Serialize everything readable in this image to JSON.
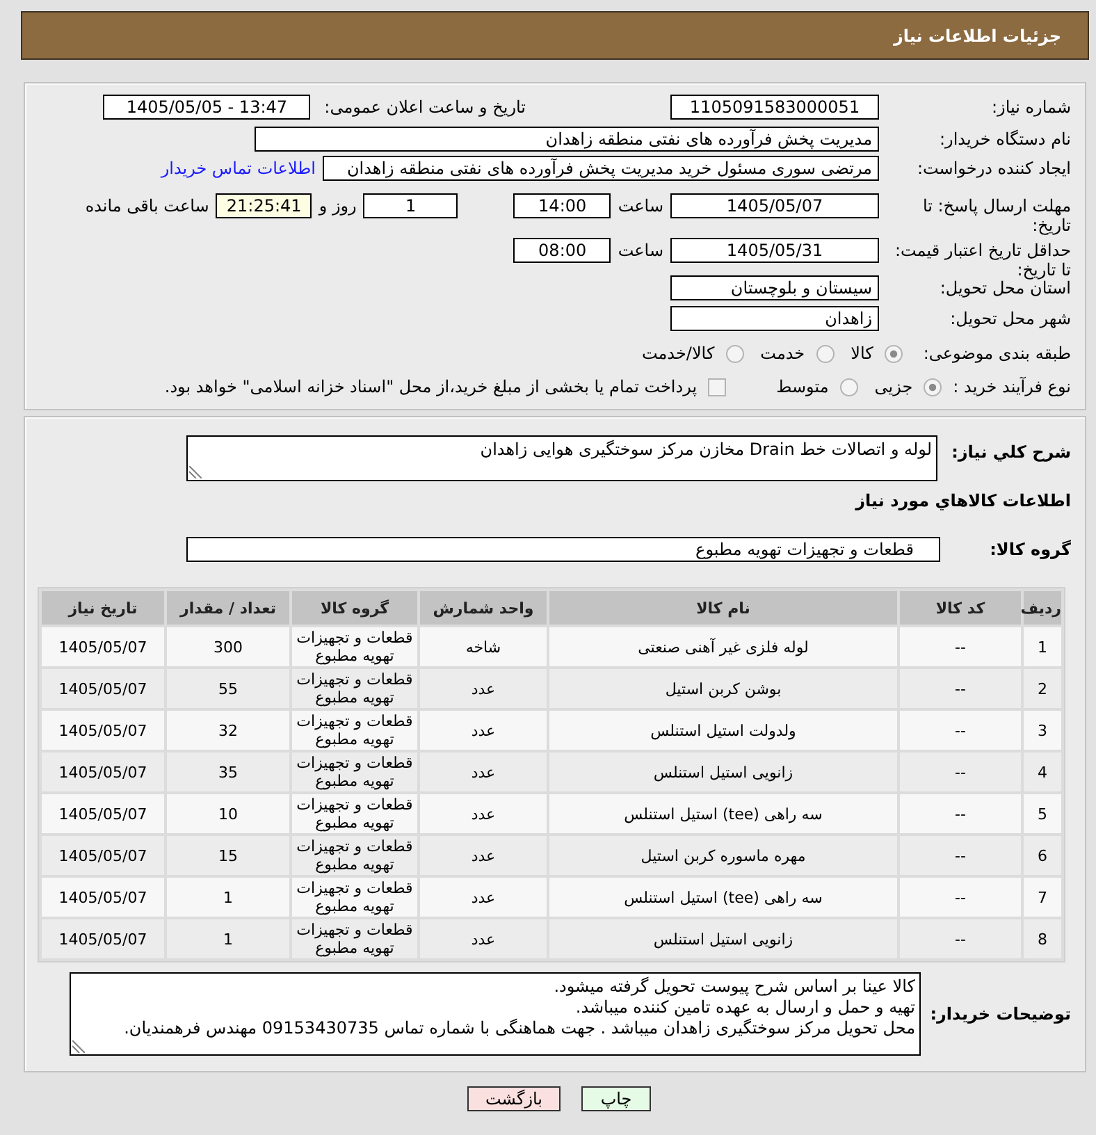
{
  "header": {
    "title": "جزئیات اطلاعات نیاز"
  },
  "request": {
    "need_number": {
      "label": "شماره نیاز:",
      "value": "1105091583000051"
    },
    "announcement": {
      "label": "تاریخ و ساعت اعلان عمومی:",
      "value": "1405/05/05 - 13:47"
    },
    "buyer": {
      "label": "نام دستگاه خریدار:",
      "value": "مدیریت پخش فرآورده های نفتی منطقه زاهدان"
    },
    "requester": {
      "label": "ایجاد کننده درخواست:",
      "value": "مرتضی سوری مسئول خرید مدیریت پخش فرآورده های نفتی منطقه زاهدان",
      "contact_link": "اطلاعات تماس خریدار"
    },
    "reply_deadline": {
      "label": "مهلت ارسال پاسخ: تا تاریخ:",
      "date": "1405/05/07",
      "time_label": "ساعت",
      "time": "14:00",
      "days": "1",
      "days_label": "روز و",
      "remaining": "21:25:41",
      "remaining_label": "ساعت باقی مانده"
    },
    "price_validity": {
      "label": "حداقل تاریخ اعتبار قیمت: تا تاریخ:",
      "date": "1405/05/31",
      "time_label": "ساعت",
      "time": "08:00"
    },
    "province": {
      "label": "استان محل تحویل:",
      "value": "سیستان و بلوچستان"
    },
    "city": {
      "label": "شهر محل تحویل:",
      "value": "زاهدان"
    },
    "category": {
      "label": "طبقه بندی موضوعی:",
      "options": [
        {
          "label": "کالا",
          "selected": true
        },
        {
          "label": "خدمت",
          "selected": false
        },
        {
          "label": "کالا/خدمت",
          "selected": false
        }
      ]
    },
    "purchase_process": {
      "label": "نوع فرآیند خرید :",
      "options": [
        {
          "label": "جزیی",
          "selected": true
        },
        {
          "label": "متوسط",
          "selected": false
        }
      ],
      "treasury_payment": {
        "label": "پرداخت تمام یا بخشی از مبلغ خرید،از محل \"اسناد خزانه اسلامی\" خواهد بود.",
        "checked": false
      }
    }
  },
  "needs": {
    "summary_label": "شرح کلي نیاز:",
    "summary": "لوله و اتصالات خط Drain مخازن مرکز سوختگیری هوایی زاهدان",
    "section_title": "اطلاعات کالاهاي مورد نیاز",
    "group_label": "گروه کالا:",
    "group": "قطعات و تجهیزات تهویه مطبوع"
  },
  "items_table": {
    "columns": [
      "ردیف",
      "کد کالا",
      "نام کالا",
      "واحد شمارش",
      "گروه کالا",
      "تعداد / مقدار",
      "تاریخ نیاز"
    ],
    "rows": [
      [
        "1",
        "--",
        "لوله فلزی غیر آهنی صنعتی",
        "شاخه",
        "قطعات و تجهیزات تهویه مطبوع",
        "300",
        "1405/05/07"
      ],
      [
        "2",
        "--",
        "بوشن کربن استیل",
        "عدد",
        "قطعات و تجهیزات تهویه مطبوع",
        "55",
        "1405/05/07"
      ],
      [
        "3",
        "--",
        "ولدولت استیل استنلس",
        "عدد",
        "قطعات و تجهیزات تهویه مطبوع",
        "32",
        "1405/05/07"
      ],
      [
        "4",
        "--",
        "زانویی استیل استنلس",
        "عدد",
        "قطعات و تجهیزات تهویه مطبوع",
        "35",
        "1405/05/07"
      ],
      [
        "5",
        "--",
        "سه راهی (tee) استیل استنلس",
        "عدد",
        "قطعات و تجهیزات تهویه مطبوع",
        "10",
        "1405/05/07"
      ],
      [
        "6",
        "--",
        "مهره ماسوره کربن استیل",
        "عدد",
        "قطعات و تجهیزات تهویه مطبوع",
        "15",
        "1405/05/07"
      ],
      [
        "7",
        "--",
        "سه راهی (tee) استیل استنلس",
        "عدد",
        "قطعات و تجهیزات تهویه مطبوع",
        "1",
        "1405/05/07"
      ],
      [
        "8",
        "--",
        "زانویی استیل استنلس",
        "عدد",
        "قطعات و تجهیزات تهویه مطبوع",
        "1",
        "1405/05/07"
      ]
    ]
  },
  "buyer_notes": {
    "label": "توضیحات خریدار:",
    "lines": [
      "کالا عینا بر اساس شرح پیوست تحویل گرفته میشود.",
      "تهیه و حمل و ارسال به عهده تامین کننده میباشد.",
      "محل تحویل مرکز سوختگیری زاهدان میباشد . جهت هماهنگی با شماره تماس 09153430735 مهندس فرهمندیان."
    ]
  },
  "buttons": [
    {
      "label": "چاپ",
      "kind": "print"
    },
    {
      "label": "بازگشت",
      "kind": "back"
    }
  ]
}
